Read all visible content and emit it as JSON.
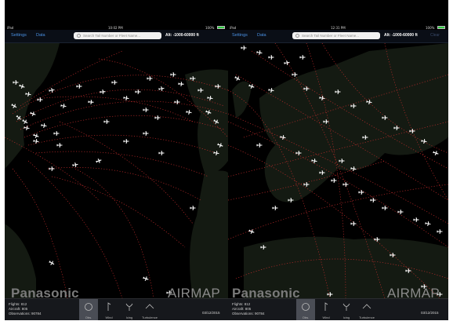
{
  "left": {
    "status": {
      "device": "iPad",
      "time": "10:02 PM",
      "battery": "100%"
    },
    "toolbar": {
      "settings": "Settings",
      "data": "Data",
      "search_placeholder": "Search Tail Number or Fleet Name...",
      "altitude": "Alt: -1000-60000 ft",
      "clear": "Clear"
    },
    "brand": {
      "logo": "Panasonic",
      "product": "AIRMAP"
    },
    "stats": {
      "flights": "Flights: 812",
      "aircraft": "Aircraft: 805",
      "observations": "Observations: 90784"
    },
    "tools": [
      {
        "label": "Obs.",
        "icon": "circle-icon"
      },
      {
        "label": "Wind",
        "icon": "wind-barb-icon"
      },
      {
        "label": "Icing",
        "icon": "icing-icon"
      },
      {
        "label": "Turbulence",
        "icon": "turbulence-icon"
      }
    ],
    "date": "03/12/2015"
  },
  "right": {
    "status": {
      "device": "iPad",
      "time": "12:31 PM",
      "battery": "100%"
    },
    "toolbar": {
      "settings": "Settings",
      "data": "Data",
      "search_placeholder": "Search Tail Number or Fleet Name...",
      "altitude": "Alt: -1000-60000 ft",
      "clear": "Clear"
    },
    "brand": {
      "logo": "Panasonic",
      "product": "AIRMAP"
    },
    "stats": {
      "flights": "Flights: 812",
      "aircraft": "Aircraft: 805",
      "observations": "Observations: 90784"
    },
    "tools": [
      {
        "label": "Obs.",
        "icon": "circle-icon"
      },
      {
        "label": "Wind",
        "icon": "wind-barb-icon"
      },
      {
        "label": "Icing",
        "icon": "icing-icon"
      },
      {
        "label": "Turbulence",
        "icon": "turbulence-icon"
      }
    ],
    "date": "03/12/2015"
  },
  "colors": {
    "track": "#d83030",
    "toolbar_link": "#4a90e2",
    "land": "#141a12",
    "selected_tool": "#4a4d55"
  }
}
